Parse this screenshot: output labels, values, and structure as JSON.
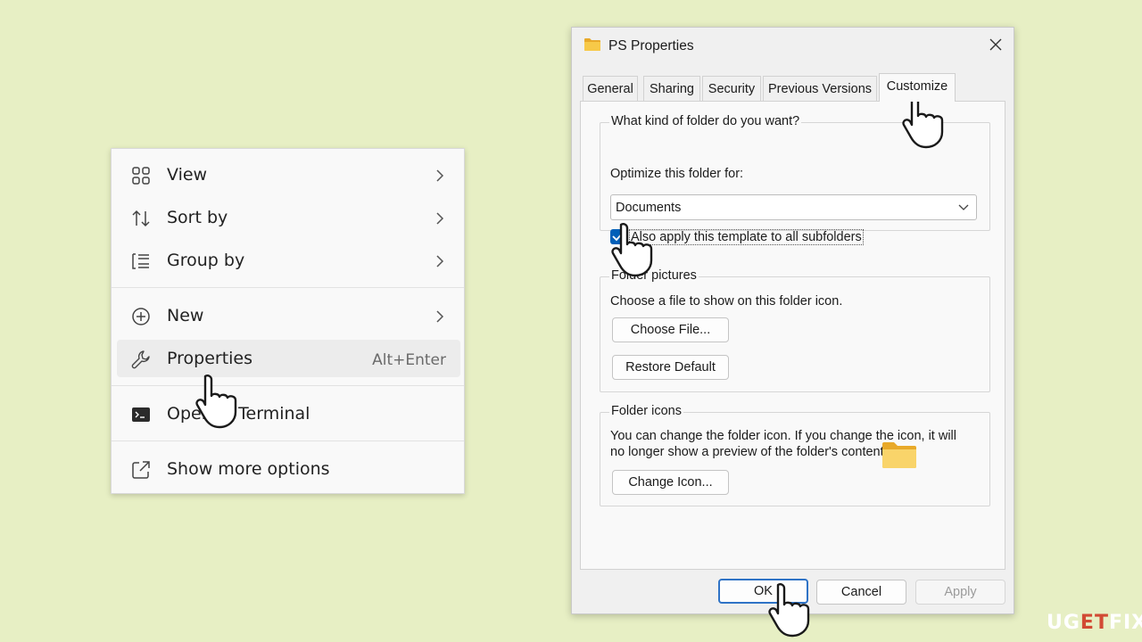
{
  "context_menu": {
    "items": [
      {
        "label": "View",
        "icon": "grid-icon",
        "has_submenu": true
      },
      {
        "label": "Sort by",
        "icon": "sort-icon",
        "has_submenu": true
      },
      {
        "label": "Group by",
        "icon": "group-list-icon",
        "has_submenu": true
      },
      {
        "label": "New",
        "icon": "plus-circle-icon",
        "has_submenu": true
      },
      {
        "label": "Properties",
        "icon": "wrench-icon",
        "shortcut": "Alt+Enter",
        "highlighted": true
      },
      {
        "label": "Open in Terminal",
        "icon": "terminal-icon"
      },
      {
        "label": "Show more options",
        "icon": "share-box-icon"
      }
    ]
  },
  "dialog": {
    "title": "PS Properties",
    "tabs": [
      "General",
      "Sharing",
      "Security",
      "Previous Versions",
      "Customize"
    ],
    "active_tab": "Customize",
    "folder_kind": {
      "group_title": "What kind of folder do you want?",
      "optimize_label": "Optimize this folder for:",
      "optimize_value": "Documents",
      "apply_subfolders_label": "Also apply this template to all subfolders",
      "apply_subfolders_checked": true
    },
    "folder_pictures": {
      "group_title": "Folder pictures",
      "description": "Choose a file to show on this folder icon.",
      "choose_file_label": "Choose File...",
      "restore_default_label": "Restore Default"
    },
    "folder_icons": {
      "group_title": "Folder icons",
      "description_line1": "You can change the folder icon. If you change the icon, it will",
      "description_line2": "no longer show a preview of the folder's contents.",
      "change_icon_label": "Change Icon..."
    },
    "buttons": {
      "ok": "OK",
      "cancel": "Cancel",
      "apply": "Apply"
    }
  },
  "watermark": {
    "part1": "UG",
    "part2": "ET",
    "part3": "FIX"
  },
  "colors": {
    "background": "#e7efc4",
    "accent_blue": "#005fb8",
    "folder_yellow": "#f7c948"
  }
}
